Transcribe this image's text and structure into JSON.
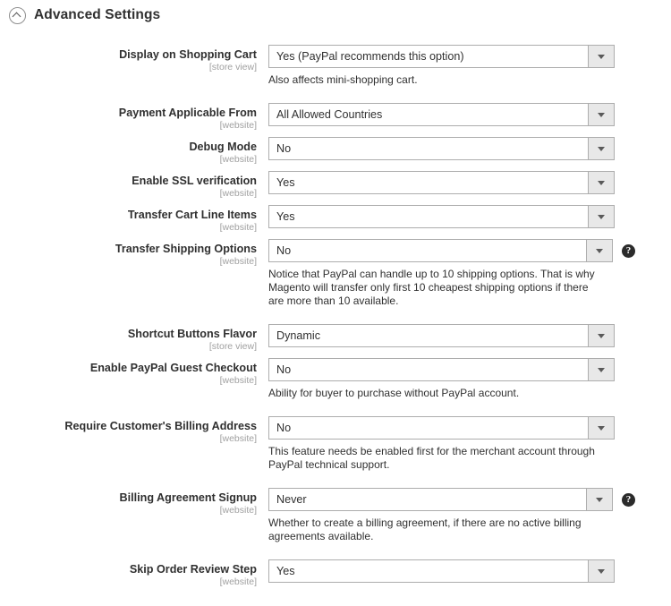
{
  "section": {
    "title": "Advanced Settings",
    "collapse_icon": "chevron-up-circle-icon"
  },
  "icons": {
    "dropdown": "chevron-down-icon",
    "help": "help-question-icon",
    "help_glyph": "?"
  },
  "fields": [
    {
      "label": "Display on Shopping Cart",
      "scope": "[store view]",
      "value": "Yes (PayPal recommends this option)",
      "hint": "Also affects mini-shopping cart.",
      "help": false
    },
    {
      "label": "Payment Applicable From",
      "scope": "[website]",
      "value": "All Allowed Countries",
      "hint": "",
      "help": false
    },
    {
      "label": "Debug Mode",
      "scope": "[website]",
      "value": "No",
      "hint": "",
      "help": false
    },
    {
      "label": "Enable SSL verification",
      "scope": "[website]",
      "value": "Yes",
      "hint": "",
      "help": false
    },
    {
      "label": "Transfer Cart Line Items",
      "scope": "[website]",
      "value": "Yes",
      "hint": "",
      "help": false
    },
    {
      "label": "Transfer Shipping Options",
      "scope": "[website]",
      "value": "No",
      "hint": "Notice that PayPal can handle up to 10 shipping options. That is why Magento will transfer only first 10 cheapest shipping options if there are more than 10 available.",
      "help": true
    },
    {
      "label": "Shortcut Buttons Flavor",
      "scope": "[store view]",
      "value": "Dynamic",
      "hint": "",
      "help": false
    },
    {
      "label": "Enable PayPal Guest Checkout",
      "scope": "[website]",
      "value": "No",
      "hint": "Ability for buyer to purchase without PayPal account.",
      "help": false
    },
    {
      "label": "Require Customer's Billing Address",
      "scope": "[website]",
      "value": "No",
      "hint": "This feature needs be enabled first for the merchant account through PayPal technical support.",
      "help": false
    },
    {
      "label": "Billing Agreement Signup",
      "scope": "[website]",
      "value": "Never",
      "hint": "Whether to create a billing agreement, if there are no active billing agreements available.",
      "help": true
    },
    {
      "label": "Skip Order Review Step",
      "scope": "[website]",
      "value": "Yes",
      "hint": "",
      "help": false
    }
  ]
}
